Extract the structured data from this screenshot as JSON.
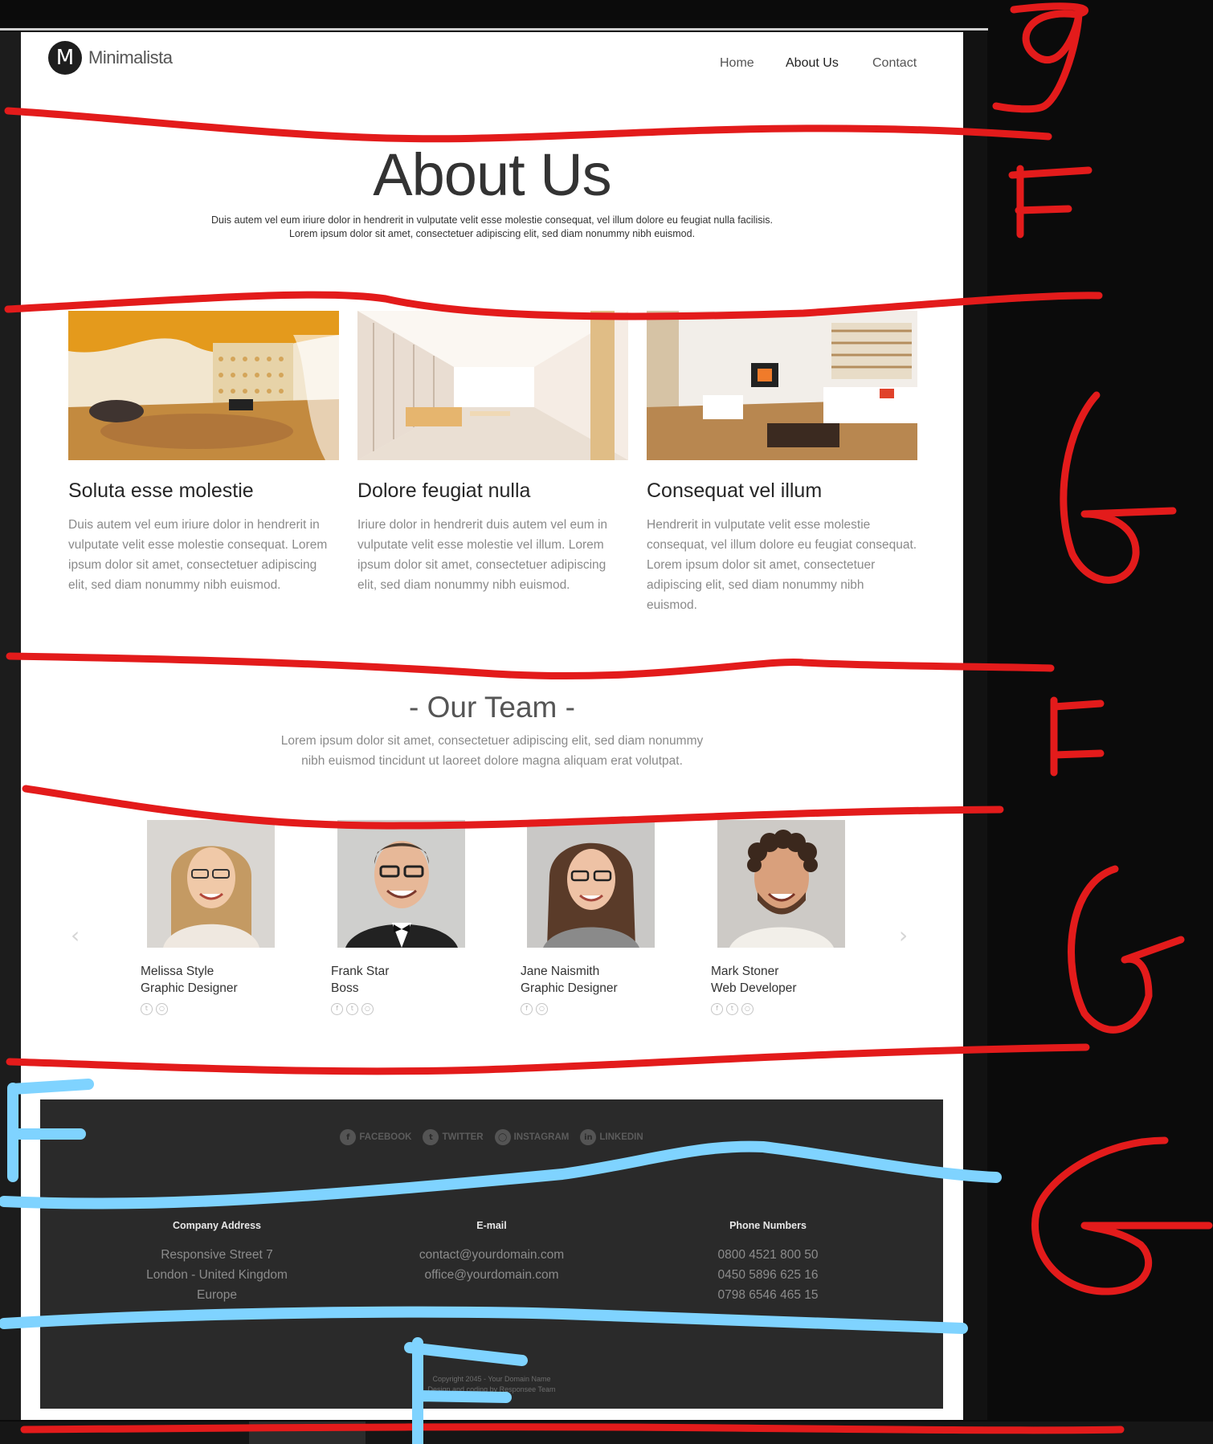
{
  "brand": {
    "logo_letter": "M",
    "name": "Minimalista"
  },
  "nav": {
    "items": [
      {
        "label": "Home",
        "active": false
      },
      {
        "label": "About Us",
        "active": true
      },
      {
        "label": "Contact",
        "active": false
      }
    ]
  },
  "hero": {
    "title": "About Us",
    "subtitle_line1": "Duis autem vel eum iriure dolor in hendrerit in vulputate velit esse molestie consequat, vel illum dolore eu feugiat nulla facilisis.",
    "subtitle_line2": "Lorem ipsum dolor sit amet, consectetuer adipiscing elit, sed diam nonummy nibh euismod."
  },
  "features": [
    {
      "title": "Soluta esse molestie",
      "text": "Duis autem vel eum iriure dolor in hendrerit in vulputate velit esse molestie consequat. Lorem ipsum dolor sit amet, consectetuer adipiscing elit, sed diam nonummy nibh euismod."
    },
    {
      "title": "Dolore feugiat nulla",
      "text": "Iriure dolor in hendrerit duis autem vel eum in vulputate velit esse molestie vel illum. Lorem ipsum dolor sit amet, consectetuer adipiscing elit, sed diam nonummy nibh euismod."
    },
    {
      "title": "Consequat vel illum",
      "text": "Hendrerit in vulputate velit esse molestie consequat, vel illum dolore eu feugiat consequat. Lorem ipsum dolor sit amet, consectetuer adipiscing elit, sed diam nonummy nibh euismod."
    }
  ],
  "team": {
    "title": "- Our Team -",
    "subtitle_line1": "Lorem ipsum dolor sit amet, consectetuer adipiscing elit, sed diam nonummy",
    "subtitle_line2": "nibh euismod tincidunt ut laoreet dolore magna aliquam erat volutpat.",
    "members": [
      {
        "name": "Melissa Style",
        "role": "Graphic Designer"
      },
      {
        "name": "Frank Star",
        "role": "Boss"
      },
      {
        "name": "Jane Naismith",
        "role": "Graphic Designer"
      },
      {
        "name": "Mark Stoner",
        "role": "Web Developer"
      }
    ]
  },
  "footer": {
    "socials": [
      "FACEBOOK",
      "TWITTER",
      "INSTAGRAM",
      "LINKEDIN"
    ],
    "columns": [
      {
        "heading": "Company Address",
        "lines": [
          "Responsive Street 7",
          "London - United Kingdom",
          "Europe"
        ]
      },
      {
        "heading": "E-mail",
        "lines": [
          "contact@yourdomain.com",
          "office@yourdomain.com"
        ]
      },
      {
        "heading": "Phone Numbers",
        "lines": [
          "0800 4521 800 50",
          "0450 5896 625 16",
          "0798 6546 465 15"
        ]
      }
    ],
    "copyright_line1": "Copyright 2045 - Your Domain Name",
    "copyright_line2": "Design and coding by Responsee Team"
  },
  "annotations": {
    "red_marks": [
      "9",
      "F",
      "G",
      "F",
      "G",
      "G"
    ],
    "blue_marks": [
      "F",
      "F"
    ],
    "red_color": "#e31b1b",
    "blue_color": "#7fd3ff"
  }
}
